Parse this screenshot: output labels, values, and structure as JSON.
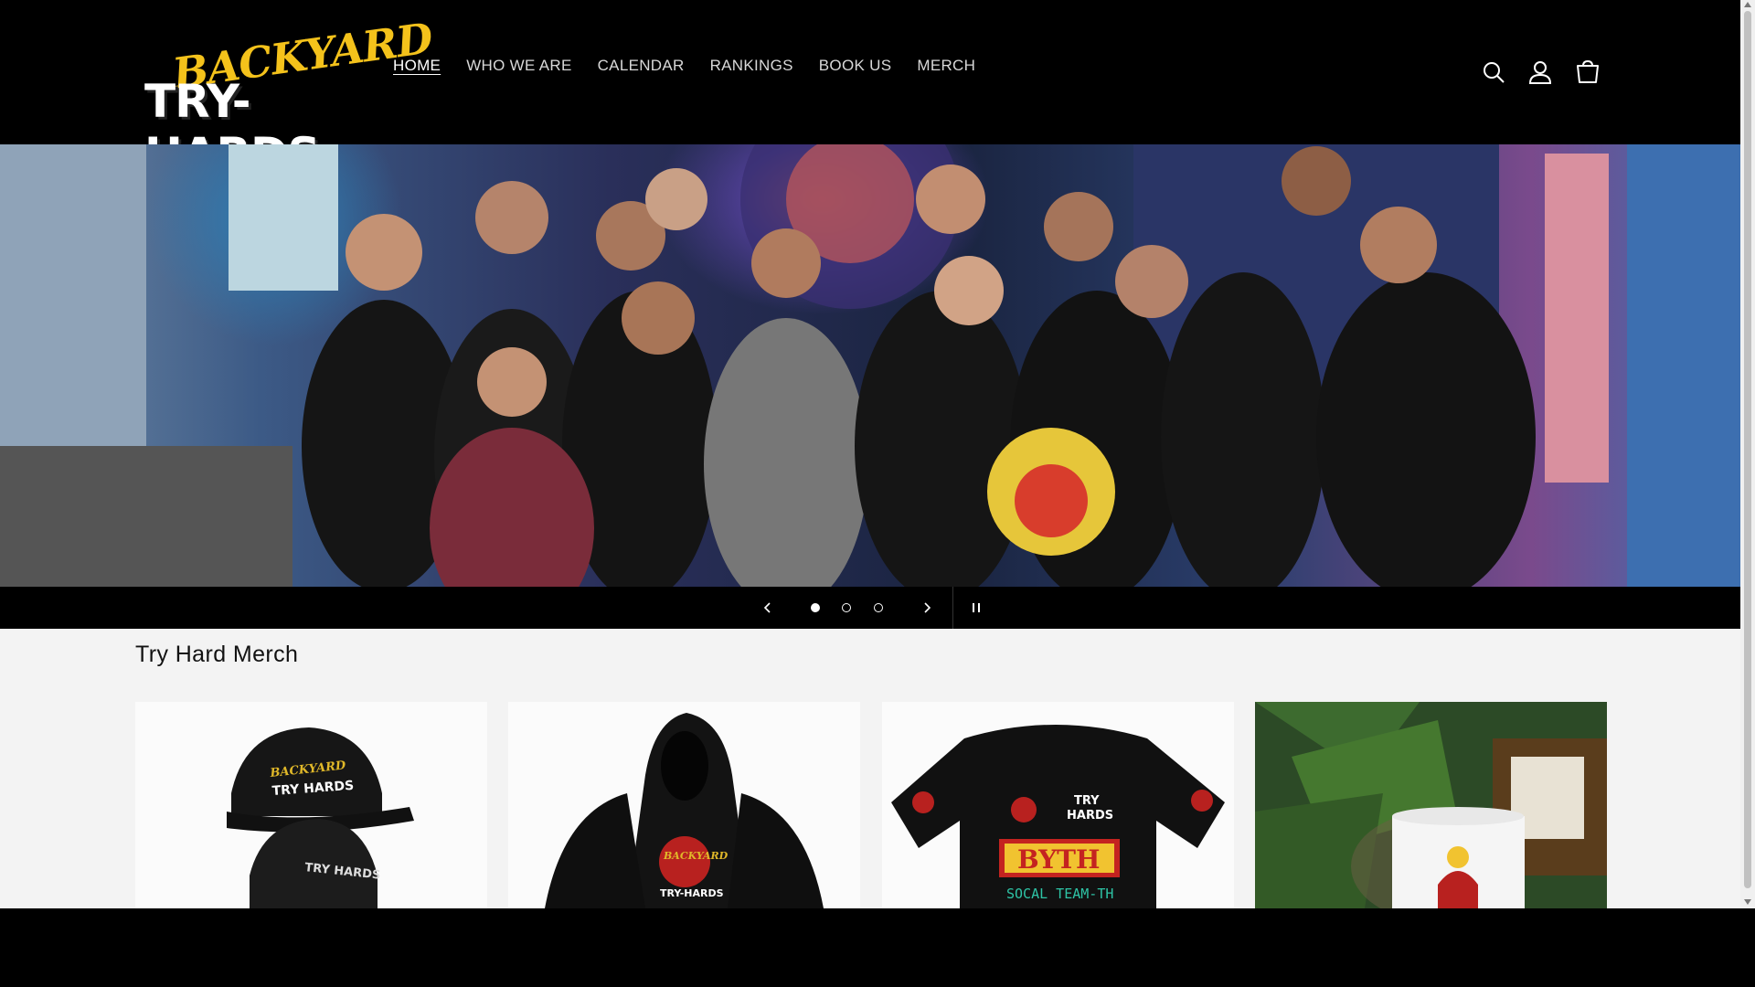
{
  "brand": {
    "line1": "BACKYARD",
    "line2": "TRY-HARDS"
  },
  "nav": {
    "items": [
      {
        "label": "HOME",
        "active": true
      },
      {
        "label": "WHO WE ARE"
      },
      {
        "label": "CALENDAR"
      },
      {
        "label": "RANKINGS"
      },
      {
        "label": "BOOK US"
      },
      {
        "label": "MERCH"
      }
    ]
  },
  "header_icons": [
    "search-icon",
    "account-icon",
    "cart-icon"
  ],
  "slideshow": {
    "slide_count": 3,
    "current_slide": 1
  },
  "merch": {
    "title": "Try Hard Merch",
    "products": [
      {
        "image": "dad-hat",
        "print_top": "BACKYARD",
        "print_bottom": "TRY HARDS"
      },
      {
        "image": "hoodie",
        "print_top": "BACKYARD",
        "print_bottom": "TRY-HARDS"
      },
      {
        "image": "tshirt",
        "print_top": "TRY",
        "print_bottom": "HARDS",
        "badge": "BYTH",
        "tagline": "SOCAL TEAM-TH"
      },
      {
        "image": "mug"
      }
    ]
  },
  "colors": {
    "header_bg": "#000000",
    "accent_yellow": "#f4c21b",
    "page_bg": "#f3f3f3"
  }
}
